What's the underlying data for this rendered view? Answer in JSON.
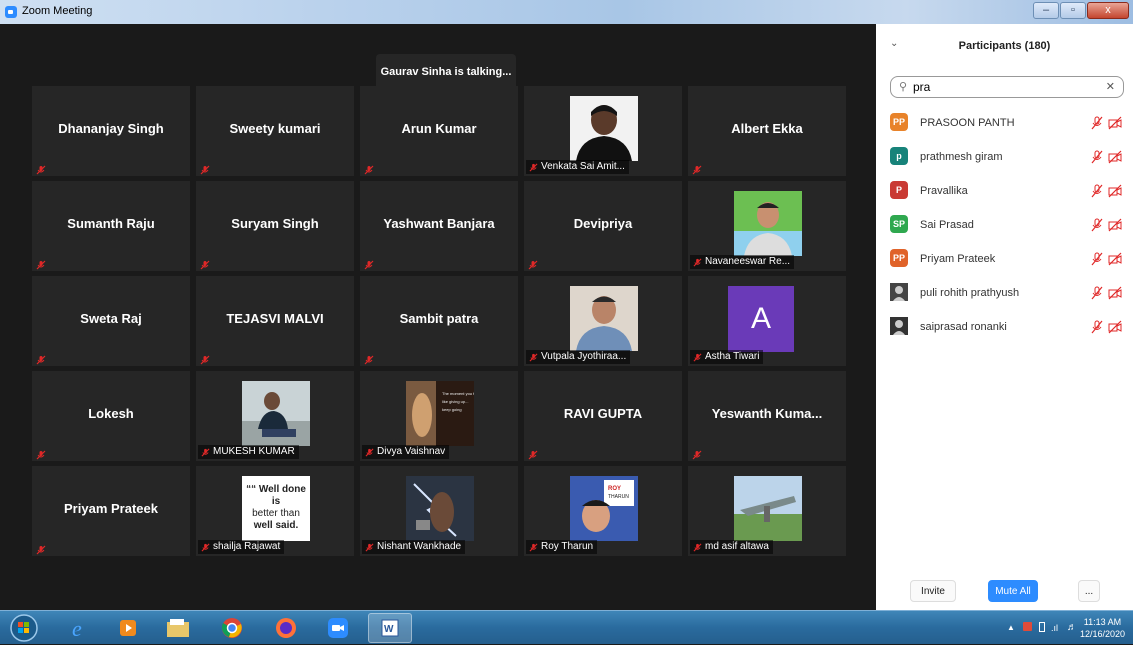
{
  "window": {
    "title": "Zoom Meeting",
    "min": "‒",
    "max": "▫",
    "close": "x"
  },
  "stage": {
    "talking": "Gaurav Sinha is talking..."
  },
  "tiles": [
    {
      "name": "Dhananjay Singh",
      "style": "name"
    },
    {
      "name": "Sweety kumari",
      "style": "name"
    },
    {
      "name": "Arun Kumar",
      "style": "name"
    },
    {
      "name": "Venkata Sai Amit...",
      "style": "photo",
      "photo": "portrait-dark"
    },
    {
      "name": "Albert Ekka",
      "style": "name"
    },
    {
      "name": "Sumanth Raju",
      "style": "name"
    },
    {
      "name": "Suryam Singh",
      "style": "name"
    },
    {
      "name": "Yashwant Banjara",
      "style": "name"
    },
    {
      "name": "Devipriya",
      "style": "name"
    },
    {
      "name": "Navaneeswar Re...",
      "style": "photo",
      "photo": "portrait-green"
    },
    {
      "name": "Sweta Raj",
      "style": "name"
    },
    {
      "name": "TEJASVI MALVI",
      "style": "name"
    },
    {
      "name": "Sambit patra",
      "style": "name"
    },
    {
      "name": "Vutpala Jyothiraa...",
      "style": "photo",
      "photo": "portrait-light"
    },
    {
      "name": "Astha Tiwari",
      "style": "letter",
      "letter": "A"
    },
    {
      "name": "Lokesh",
      "style": "name"
    },
    {
      "name": "MUKESH KUMAR",
      "style": "photo",
      "photo": "portrait-sitting"
    },
    {
      "name": "Divya Vaishnav",
      "style": "photo",
      "photo": "poster-dark"
    },
    {
      "name": "RAVI GUPTA",
      "style": "name"
    },
    {
      "name": "Yeswanth Kuma...",
      "style": "name"
    },
    {
      "name": "Priyam Prateek",
      "style": "name"
    },
    {
      "name": "shailja Rajawat",
      "style": "quote",
      "quote": [
        "““ Well done is",
        "better than",
        "well said."
      ]
    },
    {
      "name": "Nishant Wankhade",
      "style": "photo",
      "photo": "thor"
    },
    {
      "name": "Roy Tharun",
      "style": "photo",
      "photo": "roy"
    },
    {
      "name": "md asif altawa",
      "style": "photo",
      "photo": "jet"
    }
  ],
  "panel": {
    "title": "Participants (180)",
    "search_value": "pra",
    "participants": [
      {
        "initials": "PP",
        "name": "PRASOON PANTH",
        "color": "#e8832a"
      },
      {
        "initials": "p",
        "name": "prathmesh giram",
        "color": "#17837a"
      },
      {
        "initials": "P",
        "name": "Pravallika",
        "color": "#c93a34"
      },
      {
        "initials": "SP",
        "name": "Sai Prasad",
        "color": "#2fa84f"
      },
      {
        "initials": "PP",
        "name": "Priyam Prateek",
        "color": "#e0632a"
      },
      {
        "initials": "",
        "name": "puli rohith prathyush",
        "color": "#444"
      },
      {
        "initials": "",
        "name": "saiprasad ronanki",
        "color": "#333"
      }
    ],
    "invite": "Invite",
    "mute_all": "Mute All",
    "more": "..."
  },
  "taskbar": {
    "time": "11:13 AM",
    "date": "12/16/2020"
  }
}
